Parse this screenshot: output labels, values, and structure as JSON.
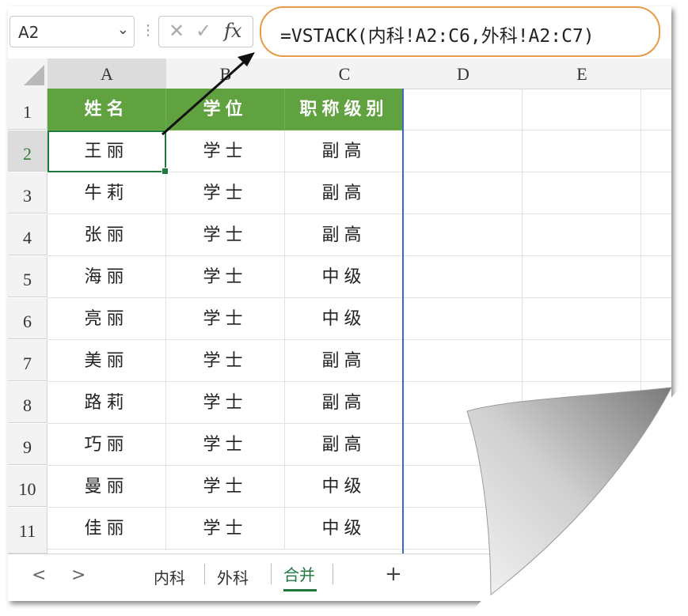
{
  "formula_bar": {
    "name_box": "A2",
    "fx_label": "fx",
    "formula": "=VSTACK(内科!A2:C6,外科!A2:C7)"
  },
  "columns": [
    "A",
    "B",
    "C",
    "D",
    "E"
  ],
  "rows": [
    "1",
    "2",
    "3",
    "4",
    "5",
    "6",
    "7",
    "8",
    "9",
    "10",
    "11"
  ],
  "table": {
    "headers": [
      "姓名",
      "学位",
      "职称级别"
    ],
    "data": [
      [
        "王丽",
        "学士",
        "副高"
      ],
      [
        "牛莉",
        "学士",
        "副高"
      ],
      [
        "张丽",
        "学士",
        "副高"
      ],
      [
        "海丽",
        "学士",
        "中级"
      ],
      [
        "亮丽",
        "学士",
        "中级"
      ],
      [
        "美丽",
        "学士",
        "副高"
      ],
      [
        "路莉",
        "学士",
        "副高"
      ],
      [
        "巧丽",
        "学士",
        "副高"
      ],
      [
        "曼丽",
        "学士",
        "中级"
      ],
      [
        "佳丽",
        "学士",
        "中级"
      ]
    ]
  },
  "sheet_tabs": {
    "nav_prev": "<",
    "nav_next": ">",
    "tabs": [
      "内科",
      "外科",
      "合并"
    ],
    "active": "合并",
    "add": "+"
  },
  "colors": {
    "header_fill": "#5fa23f",
    "formula_highlight": "#e89a45",
    "active_cell": "#1e7a3c"
  }
}
